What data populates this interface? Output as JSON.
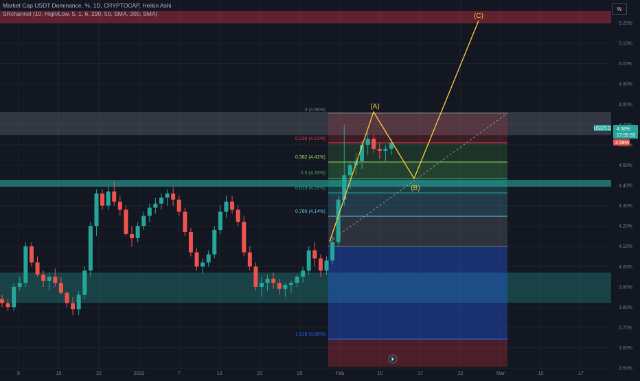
{
  "header": {
    "title": "Market Cap USDT Dominance, %, 1D, CRYPTOCAP, Heikin Ashi",
    "indicator": "SRchannel (10, High/Low, 5, 1, 6, 290, 50, SMA, 200, SMA)"
  },
  "percent_button": "%",
  "price_scale": {
    "symbol": "USDT.D",
    "price": "4.58%",
    "countdown": "17:55:55",
    "low_label": "4.58%"
  },
  "fib": [
    {
      "label": "0 (4.66%)",
      "color": "#787b86"
    },
    {
      "label": "0.236 (4.51%)",
      "color": "#f23645"
    },
    {
      "label": "0.382 (4.41%)",
      "color": "#9fd86b"
    },
    {
      "label": "0.5 (4.33%)",
      "color": "#4caf50"
    },
    {
      "label": "0.618 (4.25%)",
      "color": "#26a69a"
    },
    {
      "label": "0.786 (4.14%)",
      "color": "#5ec8e5"
    },
    {
      "label": "1.618 (3.59%)",
      "color": "#2962ff"
    }
  ],
  "waves": {
    "a": "(A)",
    "b": "(B)",
    "c": "(C)"
  },
  "colors": {
    "up": "#26a69a",
    "down": "#ef5350",
    "wave": "#f5c542"
  },
  "chart_data": {
    "type": "candlestick",
    "ylim": [
      3.48,
      5.3
    ],
    "y_ticks": [
      "5.20%",
      "5.10%",
      "5.00%",
      "4.90%",
      "4.80%",
      "4.70%",
      "4.60%",
      "4.50%",
      "4.40%",
      "4.30%",
      "4.20%",
      "4.10%",
      "4.00%",
      "3.90%",
      "3.80%",
      "3.70%",
      "3.60%",
      "3.50%"
    ],
    "x_ticks": [
      "9",
      "15",
      "22",
      "2022",
      "7",
      "13",
      "20",
      "26",
      "Feb",
      "10",
      "17",
      "22",
      "Mar",
      "10",
      "17"
    ],
    "candles": [
      [
        3.84,
        3.86,
        3.8,
        3.82
      ],
      [
        3.82,
        3.84,
        3.78,
        3.8
      ],
      [
        3.8,
        3.92,
        3.78,
        3.9
      ],
      [
        3.9,
        3.95,
        3.88,
        3.92
      ],
      [
        3.92,
        4.12,
        3.9,
        4.1
      ],
      [
        4.1,
        4.12,
        4.0,
        4.02
      ],
      [
        4.02,
        4.05,
        3.95,
        3.96
      ],
      [
        3.96,
        3.98,
        3.9,
        3.93
      ],
      [
        3.93,
        3.97,
        3.88,
        3.95
      ],
      [
        3.95,
        3.99,
        3.9,
        3.92
      ],
      [
        3.92,
        3.95,
        3.86,
        3.87
      ],
      [
        3.87,
        3.88,
        3.8,
        3.82
      ],
      [
        3.82,
        3.85,
        3.76,
        3.79
      ],
      [
        3.79,
        3.88,
        3.76,
        3.86
      ],
      [
        3.86,
        4.0,
        3.84,
        3.98
      ],
      [
        3.98,
        4.22,
        3.95,
        4.2
      ],
      [
        4.2,
        4.38,
        4.15,
        4.36
      ],
      [
        4.36,
        4.38,
        4.28,
        4.3
      ],
      [
        4.3,
        4.4,
        4.28,
        4.37
      ],
      [
        4.37,
        4.42,
        4.3,
        4.32
      ],
      [
        4.32,
        4.35,
        4.25,
        4.28
      ],
      [
        4.28,
        4.3,
        4.15,
        4.16
      ],
      [
        4.16,
        4.2,
        4.1,
        4.14
      ],
      [
        4.14,
        4.22,
        4.12,
        4.2
      ],
      [
        4.2,
        4.27,
        4.18,
        4.25
      ],
      [
        4.25,
        4.31,
        4.22,
        4.29
      ],
      [
        4.29,
        4.34,
        4.26,
        4.31
      ],
      [
        4.31,
        4.36,
        4.28,
        4.34
      ],
      [
        4.34,
        4.38,
        4.3,
        4.36
      ],
      [
        4.36,
        4.39,
        4.3,
        4.33
      ],
      [
        4.33,
        4.35,
        4.25,
        4.27
      ],
      [
        4.27,
        4.29,
        4.15,
        4.17
      ],
      [
        4.17,
        4.19,
        4.05,
        4.07
      ],
      [
        4.07,
        4.09,
        3.98,
        4.0
      ],
      [
        4.0,
        4.04,
        3.96,
        4.02
      ],
      [
        4.02,
        4.08,
        4.0,
        4.06
      ],
      [
        4.06,
        4.2,
        4.04,
        4.18
      ],
      [
        4.18,
        4.3,
        4.16,
        4.27
      ],
      [
        4.27,
        4.35,
        4.24,
        4.32
      ],
      [
        4.32,
        4.35,
        4.26,
        4.28
      ],
      [
        4.28,
        4.3,
        4.2,
        4.22
      ],
      [
        4.22,
        4.25,
        4.05,
        4.07
      ],
      [
        4.07,
        4.1,
        3.98,
        4.0
      ],
      [
        4.0,
        4.02,
        3.88,
        3.9
      ],
      [
        3.9,
        3.95,
        3.85,
        3.92
      ],
      [
        3.92,
        3.96,
        3.88,
        3.94
      ],
      [
        3.94,
        3.97,
        3.89,
        3.92
      ],
      [
        3.92,
        3.94,
        3.86,
        3.89
      ],
      [
        3.89,
        3.92,
        3.85,
        3.91
      ],
      [
        3.91,
        3.93,
        3.87,
        3.92
      ],
      [
        3.92,
        3.96,
        3.9,
        3.95
      ],
      [
        3.95,
        4.0,
        3.92,
        3.98
      ],
      [
        3.98,
        4.1,
        3.96,
        4.08
      ],
      [
        4.08,
        4.12,
        4.0,
        4.04
      ],
      [
        4.04,
        4.06,
        3.95,
        3.98
      ],
      [
        3.98,
        4.05,
        3.96,
        4.03
      ],
      [
        4.03,
        4.15,
        4.01,
        4.12
      ],
      [
        4.12,
        4.35,
        4.1,
        4.33
      ],
      [
        4.33,
        4.7,
        4.3,
        4.45
      ],
      [
        4.45,
        4.52,
        4.38,
        4.5
      ],
      [
        4.5,
        4.56,
        4.45,
        4.52
      ],
      [
        4.52,
        4.62,
        4.48,
        4.6
      ],
      [
        4.6,
        4.66,
        4.55,
        4.63
      ],
      [
        4.63,
        4.65,
        4.56,
        4.58
      ],
      [
        4.58,
        4.61,
        4.53,
        4.57
      ],
      [
        4.57,
        4.6,
        4.52,
        4.58
      ],
      [
        4.58,
        4.63,
        4.55,
        4.61
      ]
    ]
  }
}
